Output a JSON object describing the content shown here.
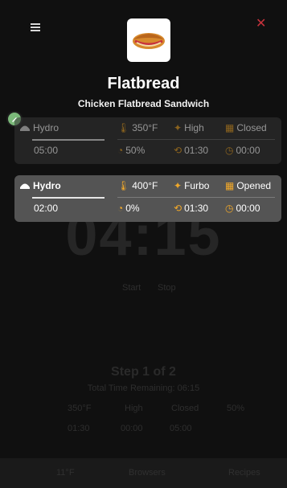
{
  "header": {
    "menu_icon": "hamburger-menu-icon",
    "close_icon": "close-x-icon",
    "close_glyph": "✕",
    "accent_close": "#c8323c"
  },
  "product": {
    "image_icon": "sandwich-image",
    "title": "Flatbread",
    "subtitle": "Chicken Flatbread Sandwich"
  },
  "previous_card": {
    "mode": "Hydro",
    "temperature": "350°F",
    "fan": "High",
    "door": "Closed",
    "time": "05:00",
    "power": "50%",
    "extra_time": "01:30",
    "hold_time": "00:00"
  },
  "current_card": {
    "mode": "Hydro",
    "temperature": "400°F",
    "fan": "Furbo",
    "door": "Opened",
    "time": "02:00",
    "power": "0%",
    "extra_time": "01:30",
    "hold_time": "00:00"
  },
  "background": {
    "big_timer": "04:15",
    "small_labels": [
      "Start",
      "Stop"
    ],
    "step_label": "Step 1 of 2",
    "step_sub": "Total Time Remaining: 06:15",
    "info_row1": [
      "350°F",
      "High",
      "Closed",
      "50%"
    ],
    "info_row2": [
      "01:30",
      "00:00",
      "05:00"
    ],
    "footer": [
      "11°F",
      "Browsers",
      "Recipes"
    ]
  },
  "colors": {
    "background": "#101010",
    "card_current": "#545454",
    "card_previous": "#363636",
    "icon_orange": "#f0a82a",
    "badge_green": "#7bb97a"
  }
}
